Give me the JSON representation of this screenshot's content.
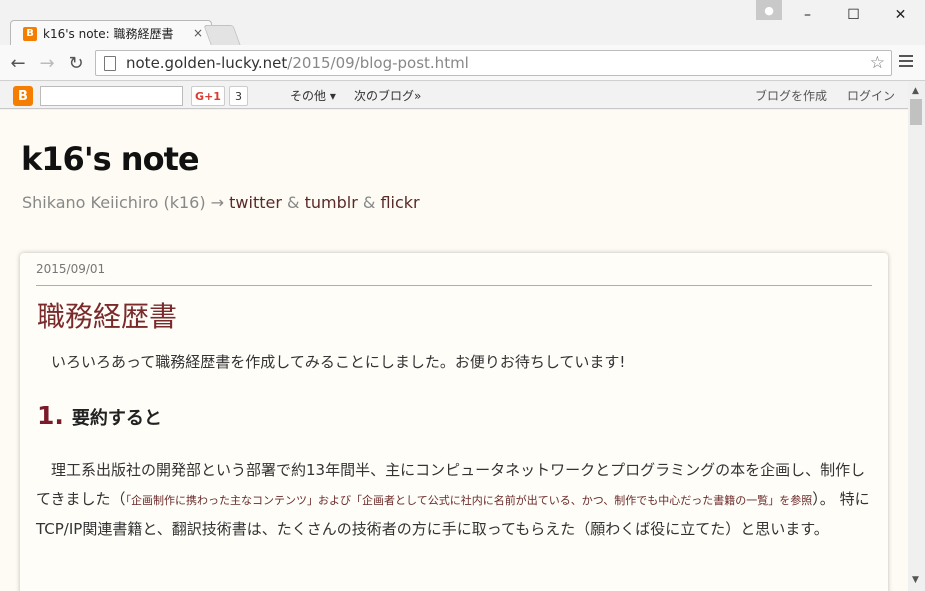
{
  "browser": {
    "tab_title": "k16's note: 職務経歴書",
    "tab_close": "×",
    "favicon_letter": "B",
    "url_host": "note.golden-lucky.net",
    "url_path": "/2015/09/blog-post.html"
  },
  "window": {
    "minimize": "–",
    "maximize": "☐",
    "close": "✕"
  },
  "navbar": {
    "logo": "B",
    "search_value": "",
    "gplus_label": "G+1",
    "gplus_count": "3",
    "more_label": "その他 ▾",
    "next_blog_label": "次のブログ»",
    "create_blog_label": "ブログを作成",
    "login_label": "ログイン"
  },
  "blog": {
    "title": "k16's note",
    "author": "Shikano Keiichiro (k16) →",
    "link_twitter": "twitter",
    "amp1": "&",
    "link_tumblr": "tumblr",
    "amp2": "&",
    "link_flickr": "flickr"
  },
  "post": {
    "date": "2015/09/01",
    "title": "職務経歴書",
    "intro": "いろいろあって職務経歴書を作成してみることにしました。お便りお待ちしています!",
    "section_number": "1.",
    "section_title": "要約すると",
    "body_part1": "理工系出版社の開発部という部署で約13年間半、主にコンピュータネットワークとプログラミングの本を企画し、制作してきました（",
    "body_small": "「企画制作に携わった主なコンテンツ」および「企画者として公式に社内に名前が出ている、かつ、制作でも中心だった書籍の一覧」を参照",
    "body_part2": "）。 特にTCP/IP関連書籍と、翻訳技術書は、たくさんの技術者の方に手に取ってもらえた（願わくば役に立てた）と思います。"
  },
  "colors": {
    "blogger_orange": "#f57d00",
    "title_red": "#7a2a2a",
    "page_bg": "#fdfbf3"
  }
}
